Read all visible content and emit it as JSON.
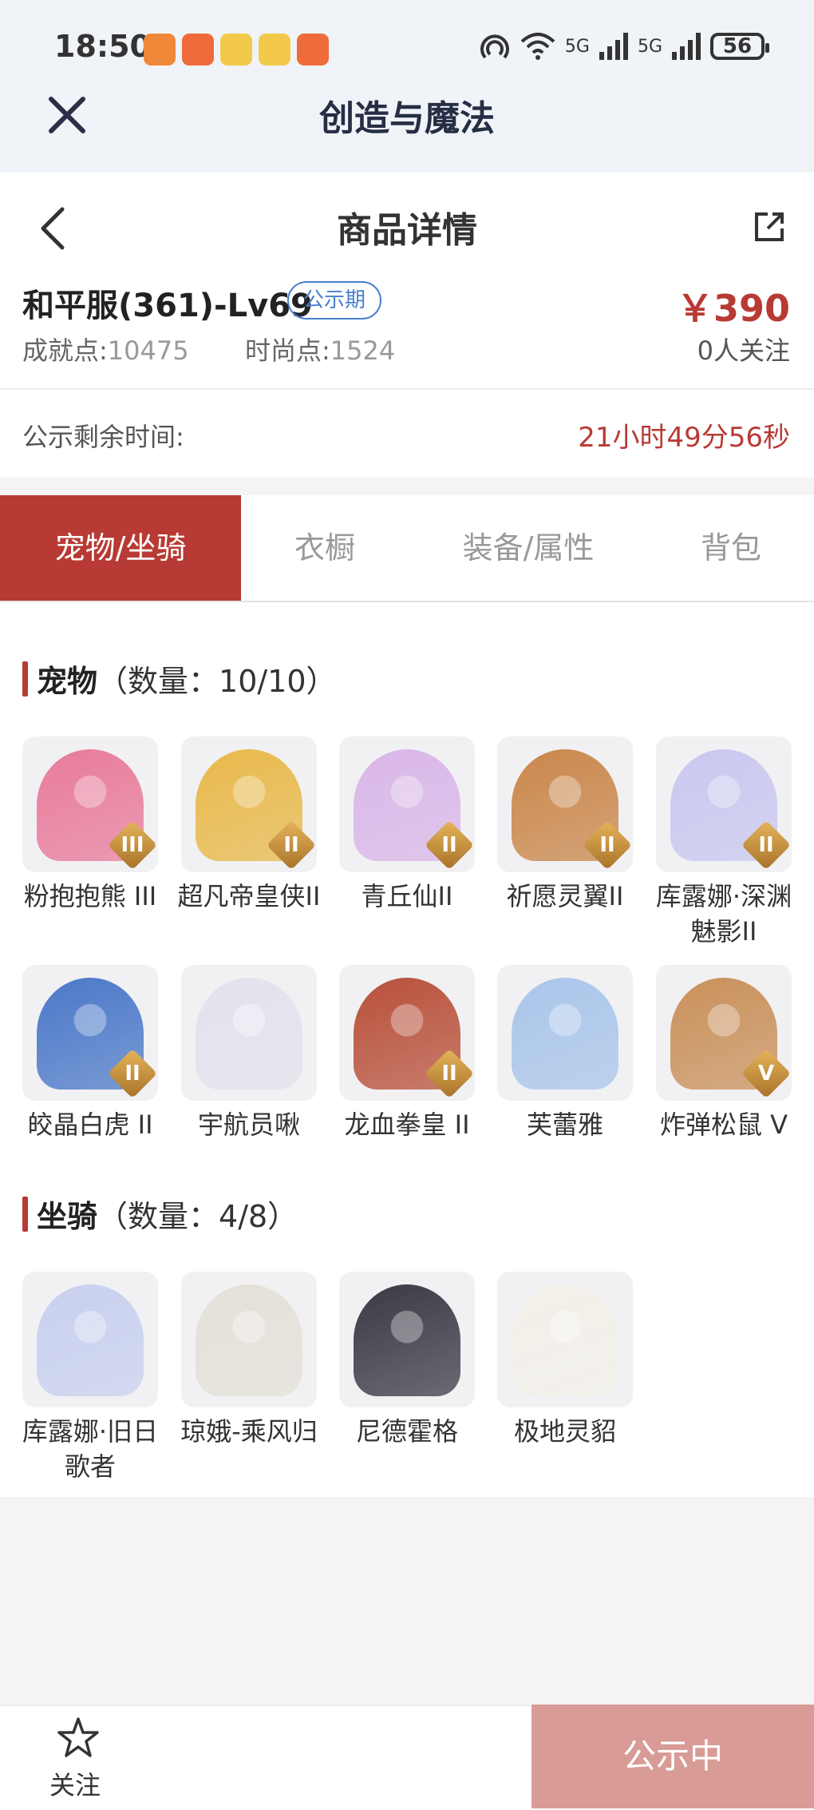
{
  "status_bar": {
    "time": "18:50",
    "network_labels": [
      "5G",
      "5G"
    ],
    "battery": "56"
  },
  "app_bar": {
    "title": "创造与魔法"
  },
  "header": {
    "title": "商品详情"
  },
  "listing": {
    "server": "和平服(361)-Lv69",
    "badge": "公示期",
    "price": "￥390",
    "followers": "0人关注",
    "achievement_label": "成就点:",
    "achievement_value": "10475",
    "fashion_label": "时尚点:",
    "fashion_value": "1524",
    "timer_label": "公示剩余时间:",
    "timer_value": "21小时49分56秒"
  },
  "tabs": [
    "宠物/坐骑",
    "衣橱",
    "装备/属性",
    "背包"
  ],
  "pets": {
    "title": "宠物",
    "count": "（数量：10/10）",
    "items": [
      {
        "name": "粉抱抱熊 III",
        "tier": "III",
        "color": "#e87a9a"
      },
      {
        "name": "超凡帝皇侠II",
        "tier": "II",
        "color": "#e8b84a"
      },
      {
        "name": "青丘仙II",
        "tier": "II",
        "color": "#d9b6e8"
      },
      {
        "name": "祈愿灵翼II",
        "tier": "II",
        "color": "#c9864a"
      },
      {
        "name": "库露娜·深渊魅影II",
        "tier": "II",
        "color": "#c9c7ef"
      },
      {
        "name": "皎晶白虎 II",
        "tier": "II",
        "color": "#4b78c8"
      },
      {
        "name": "宇航员啾",
        "tier": "",
        "color": "#e2e2ee"
      },
      {
        "name": "龙血拳皇 II",
        "tier": "II",
        "color": "#b8503a"
      },
      {
        "name": "芙蕾雅",
        "tier": "",
        "color": "#a9c5ea"
      },
      {
        "name": "炸弹松鼠 V",
        "tier": "V",
        "color": "#c9905a"
      }
    ]
  },
  "mounts": {
    "title": "坐骑",
    "count": "（数量：4/8）",
    "items": [
      {
        "name": "库露娜·旧日歌者",
        "color": "#c8d0ef"
      },
      {
        "name": "琼娥-乘风归",
        "color": "#e4e0d8"
      },
      {
        "name": "尼德霍格",
        "color": "#3b3844"
      },
      {
        "name": "极地灵貂",
        "color": "#f2efe8"
      }
    ]
  },
  "bottom_bar": {
    "follow_label": "关注",
    "cta_label": "公示中"
  },
  "colors": {
    "accent": "#b83a34",
    "badge": "#4a7fcf",
    "cta": "#d89b96"
  }
}
